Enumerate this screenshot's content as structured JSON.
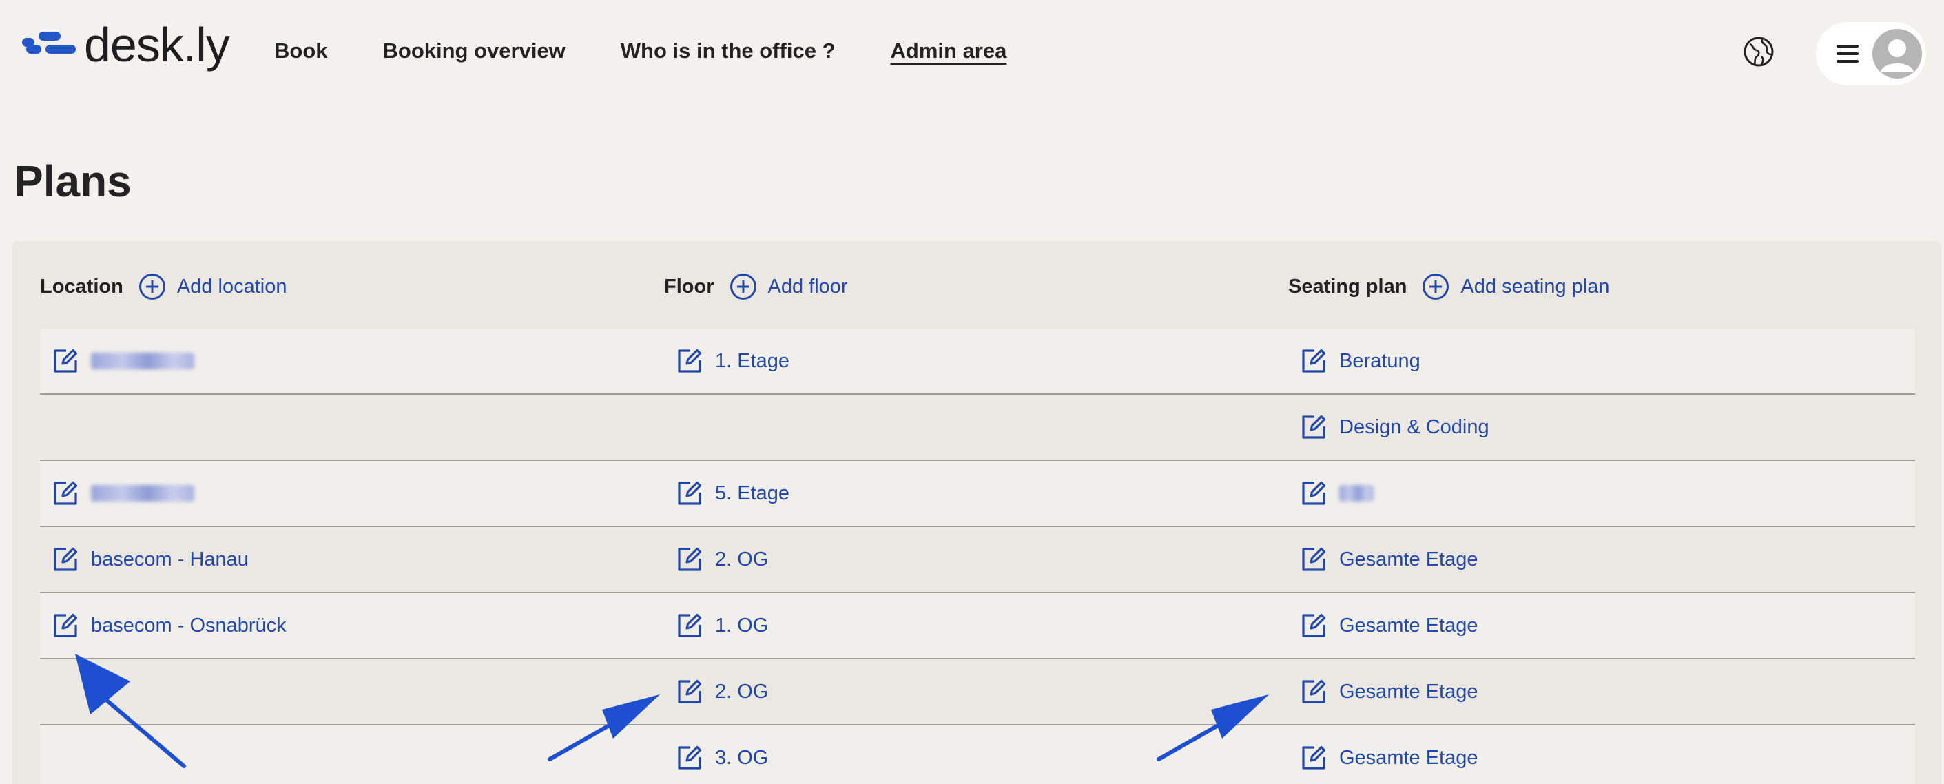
{
  "header": {
    "logo_text": "desk.ly",
    "nav": [
      {
        "label": "Book",
        "active": false
      },
      {
        "label": "Booking overview",
        "active": false
      },
      {
        "label": "Who is in the office ?",
        "active": false
      },
      {
        "label": "Admin area",
        "active": true
      }
    ],
    "icons": {
      "language": "globe-icon",
      "menu": "hamburger-menu-icon",
      "avatar": "user-avatar-icon"
    }
  },
  "page": {
    "title": "Plans"
  },
  "columns": {
    "location": {
      "label": "Location",
      "add_label": "Add location"
    },
    "floor": {
      "label": "Floor",
      "add_label": "Add floor"
    },
    "seating": {
      "label": "Seating plan",
      "add_label": "Add seating plan"
    }
  },
  "rows": [
    {
      "location": "",
      "location_blurred": true,
      "floor": "1. Etage",
      "seating": "Beratung"
    },
    {
      "location": null,
      "floor": null,
      "seating": "Design & Coding"
    },
    {
      "location": "",
      "location_blurred": true,
      "floor": "5. Etage",
      "seating": "",
      "seating_blurred": true
    },
    {
      "location": "basecom - Hanau",
      "floor": "2. OG",
      "seating": "Gesamte Etage"
    },
    {
      "location": "basecom - Osnabrück",
      "floor": "1. OG",
      "seating": "Gesamte Etage"
    },
    {
      "location": null,
      "floor": "2. OG",
      "seating": "Gesamte Etage"
    },
    {
      "location": null,
      "floor": "3. OG",
      "seating": "Gesamte Etage"
    }
  ],
  "colors": {
    "accent": "#2348a8",
    "brand": "#2557c8",
    "background": "#f3f1ee",
    "annotation_arrow": "#1f4fd1"
  }
}
